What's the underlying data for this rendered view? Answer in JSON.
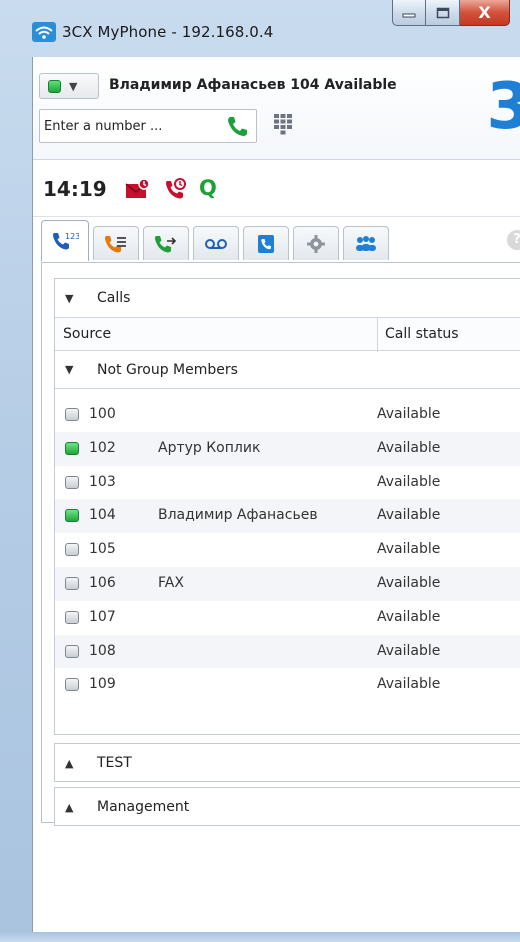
{
  "window": {
    "title": "3CX MyPhone - 192.168.0.4",
    "close_label": "X"
  },
  "header": {
    "status": "available",
    "user_line": "Владимир Афанасьев 104 Available",
    "brand": "3",
    "dial_placeholder": "Enter a number ..."
  },
  "clock": {
    "time": "14:19"
  },
  "tabs": [
    {
      "icon": "extensions-icon",
      "active": true
    },
    {
      "icon": "call-history-icon",
      "active": false
    },
    {
      "icon": "call-forward-icon",
      "active": false
    },
    {
      "icon": "voicemail-icon",
      "active": false
    },
    {
      "icon": "phonebook-icon",
      "active": false
    },
    {
      "icon": "settings-icon",
      "active": false
    },
    {
      "icon": "group-icon",
      "active": false
    }
  ],
  "calls": {
    "title": "Calls",
    "col_source": "Source",
    "col_status": "Call status"
  },
  "group": {
    "title": "Not Group Members",
    "rows": [
      {
        "ext": "100",
        "name": "",
        "status": "Available",
        "online": false
      },
      {
        "ext": "102",
        "name": "Артур Коплик",
        "status": "Available",
        "online": true
      },
      {
        "ext": "103",
        "name": "",
        "status": "Available",
        "online": false
      },
      {
        "ext": "104",
        "name": "Владимир Афанасьев",
        "status": "Available",
        "online": true
      },
      {
        "ext": "105",
        "name": "",
        "status": "Available",
        "online": false
      },
      {
        "ext": "106",
        "name": "FAX",
        "status": "Available",
        "online": false
      },
      {
        "ext": "107",
        "name": "",
        "status": "Available",
        "online": false
      },
      {
        "ext": "108",
        "name": "",
        "status": "Available",
        "online": false
      },
      {
        "ext": "109",
        "name": "",
        "status": "Available",
        "online": false
      }
    ]
  },
  "groups_collapsed": [
    {
      "title": "TEST"
    },
    {
      "title": "Management"
    }
  ],
  "colors": {
    "accent": "#1f7fd4",
    "online": "#1fa43e",
    "alert": "#c8102e"
  }
}
